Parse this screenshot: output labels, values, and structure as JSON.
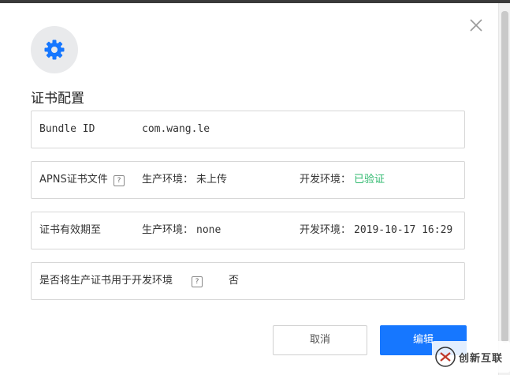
{
  "dialog": {
    "title": "证书配置",
    "rows": [
      {
        "label": "Bundle ID",
        "value": "com.wang.le"
      },
      {
        "label": "APNS证书文件",
        "prod_label": "生产环境：",
        "prod_value": "未上传",
        "dev_label": "开发环境：",
        "dev_value": "已验证"
      },
      {
        "label": "证书有效期至",
        "prod_label": "生产环境：",
        "prod_value": "none",
        "dev_label": "开发环境：",
        "dev_value": "2019-10-17 16:29"
      },
      {
        "label": "是否将生产证书用于开发环境",
        "value": "否"
      }
    ],
    "buttons": {
      "cancel": "取消",
      "edit": "编辑"
    },
    "help_glyph": "?"
  },
  "colors": {
    "accent": "#1677ff",
    "verified": "#2db86d",
    "gear": "#1677ff"
  },
  "icons": [
    "close-icon",
    "gear-icon",
    "help-icon"
  ]
}
